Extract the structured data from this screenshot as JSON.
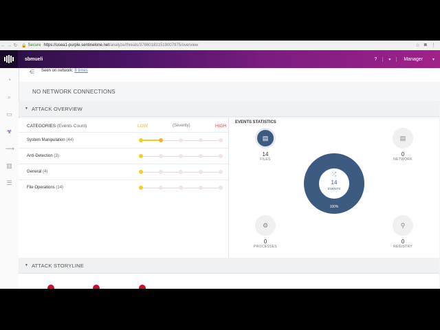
{
  "browser": {
    "secure_label": "Secure",
    "url_host": "https://usea1-purple.sentinelone.net",
    "url_path": "/analyze/threats/378601831519007975/overview"
  },
  "header": {
    "username": "sbmueli",
    "help": "?",
    "role": "Manager"
  },
  "network": {
    "seen_label": "Seen on network:",
    "seen_link": "8 times",
    "no_connections": "NO NETWORK CONNECTIONS"
  },
  "attack_overview": {
    "title": "ATTACK OVERVIEW",
    "categories_label": "CATEGORIES",
    "events_count_label": "(Events Count)",
    "low": "LOW",
    "severity": "(Severity)",
    "high": "HIGH",
    "rows": [
      {
        "name": "System Manipulation",
        "count": "(44)",
        "level": 0.2
      },
      {
        "name": "Anti-Detection",
        "count": "(3)",
        "level": 0
      },
      {
        "name": "General",
        "count": "(4)",
        "level": 0
      },
      {
        "name": "File Operations",
        "count": "(14)",
        "level": 0
      }
    ]
  },
  "events_statistics": {
    "title": "EVENTS STATISTICS",
    "files": {
      "value": "14",
      "label": "FILES"
    },
    "network": {
      "value": "0",
      "label": "NETWORK"
    },
    "processes": {
      "value": "0",
      "label": "PROCESSES"
    },
    "registry": {
      "value": "0",
      "label": "REGISTRY"
    },
    "center": {
      "value": "14",
      "label": "EVENTS",
      "percent": "100%"
    },
    "colors": {
      "primary": "#3d5a80"
    }
  },
  "story_line": {
    "title": "ATTACK STORYLINE"
  }
}
